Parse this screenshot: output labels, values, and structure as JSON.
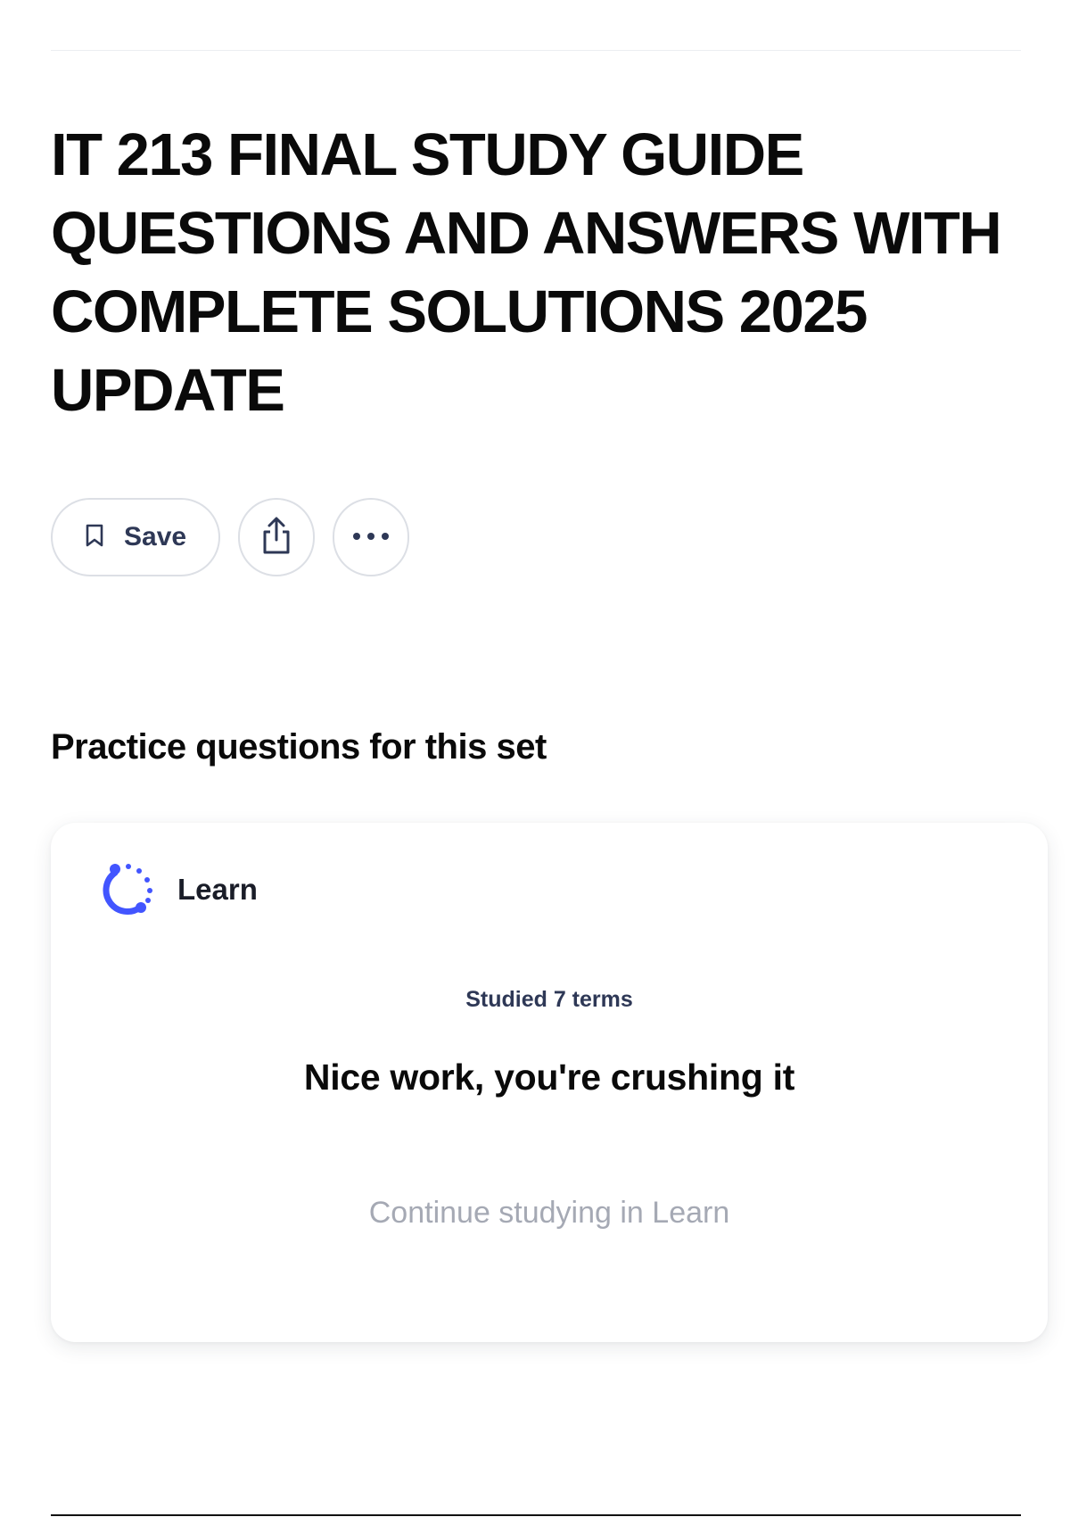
{
  "title": "IT 213 FINAL STUDY GUIDE QUESTIONS AND ANSWERS WITH COMPLETE SOLUTIONS 2025 UPDATE",
  "actions": {
    "save_label": "Save",
    "icons": [
      "bookmark-icon",
      "share-icon",
      "more-options-icon"
    ]
  },
  "practice": {
    "heading": "Practice questions for this set",
    "card": {
      "mode_label": "Learn",
      "mode_icon": "learn-progress-icon",
      "studied_text": "Studied 7 terms",
      "message": "Nice work, you're crushing it",
      "continue_label": "Continue studying in Learn"
    }
  },
  "colors": {
    "text_primary": "#0a0a0a",
    "text_secondary": "#2e3856",
    "muted": "#a5a9b4",
    "accent": "#4255ff",
    "border": "#dcdfe5"
  }
}
